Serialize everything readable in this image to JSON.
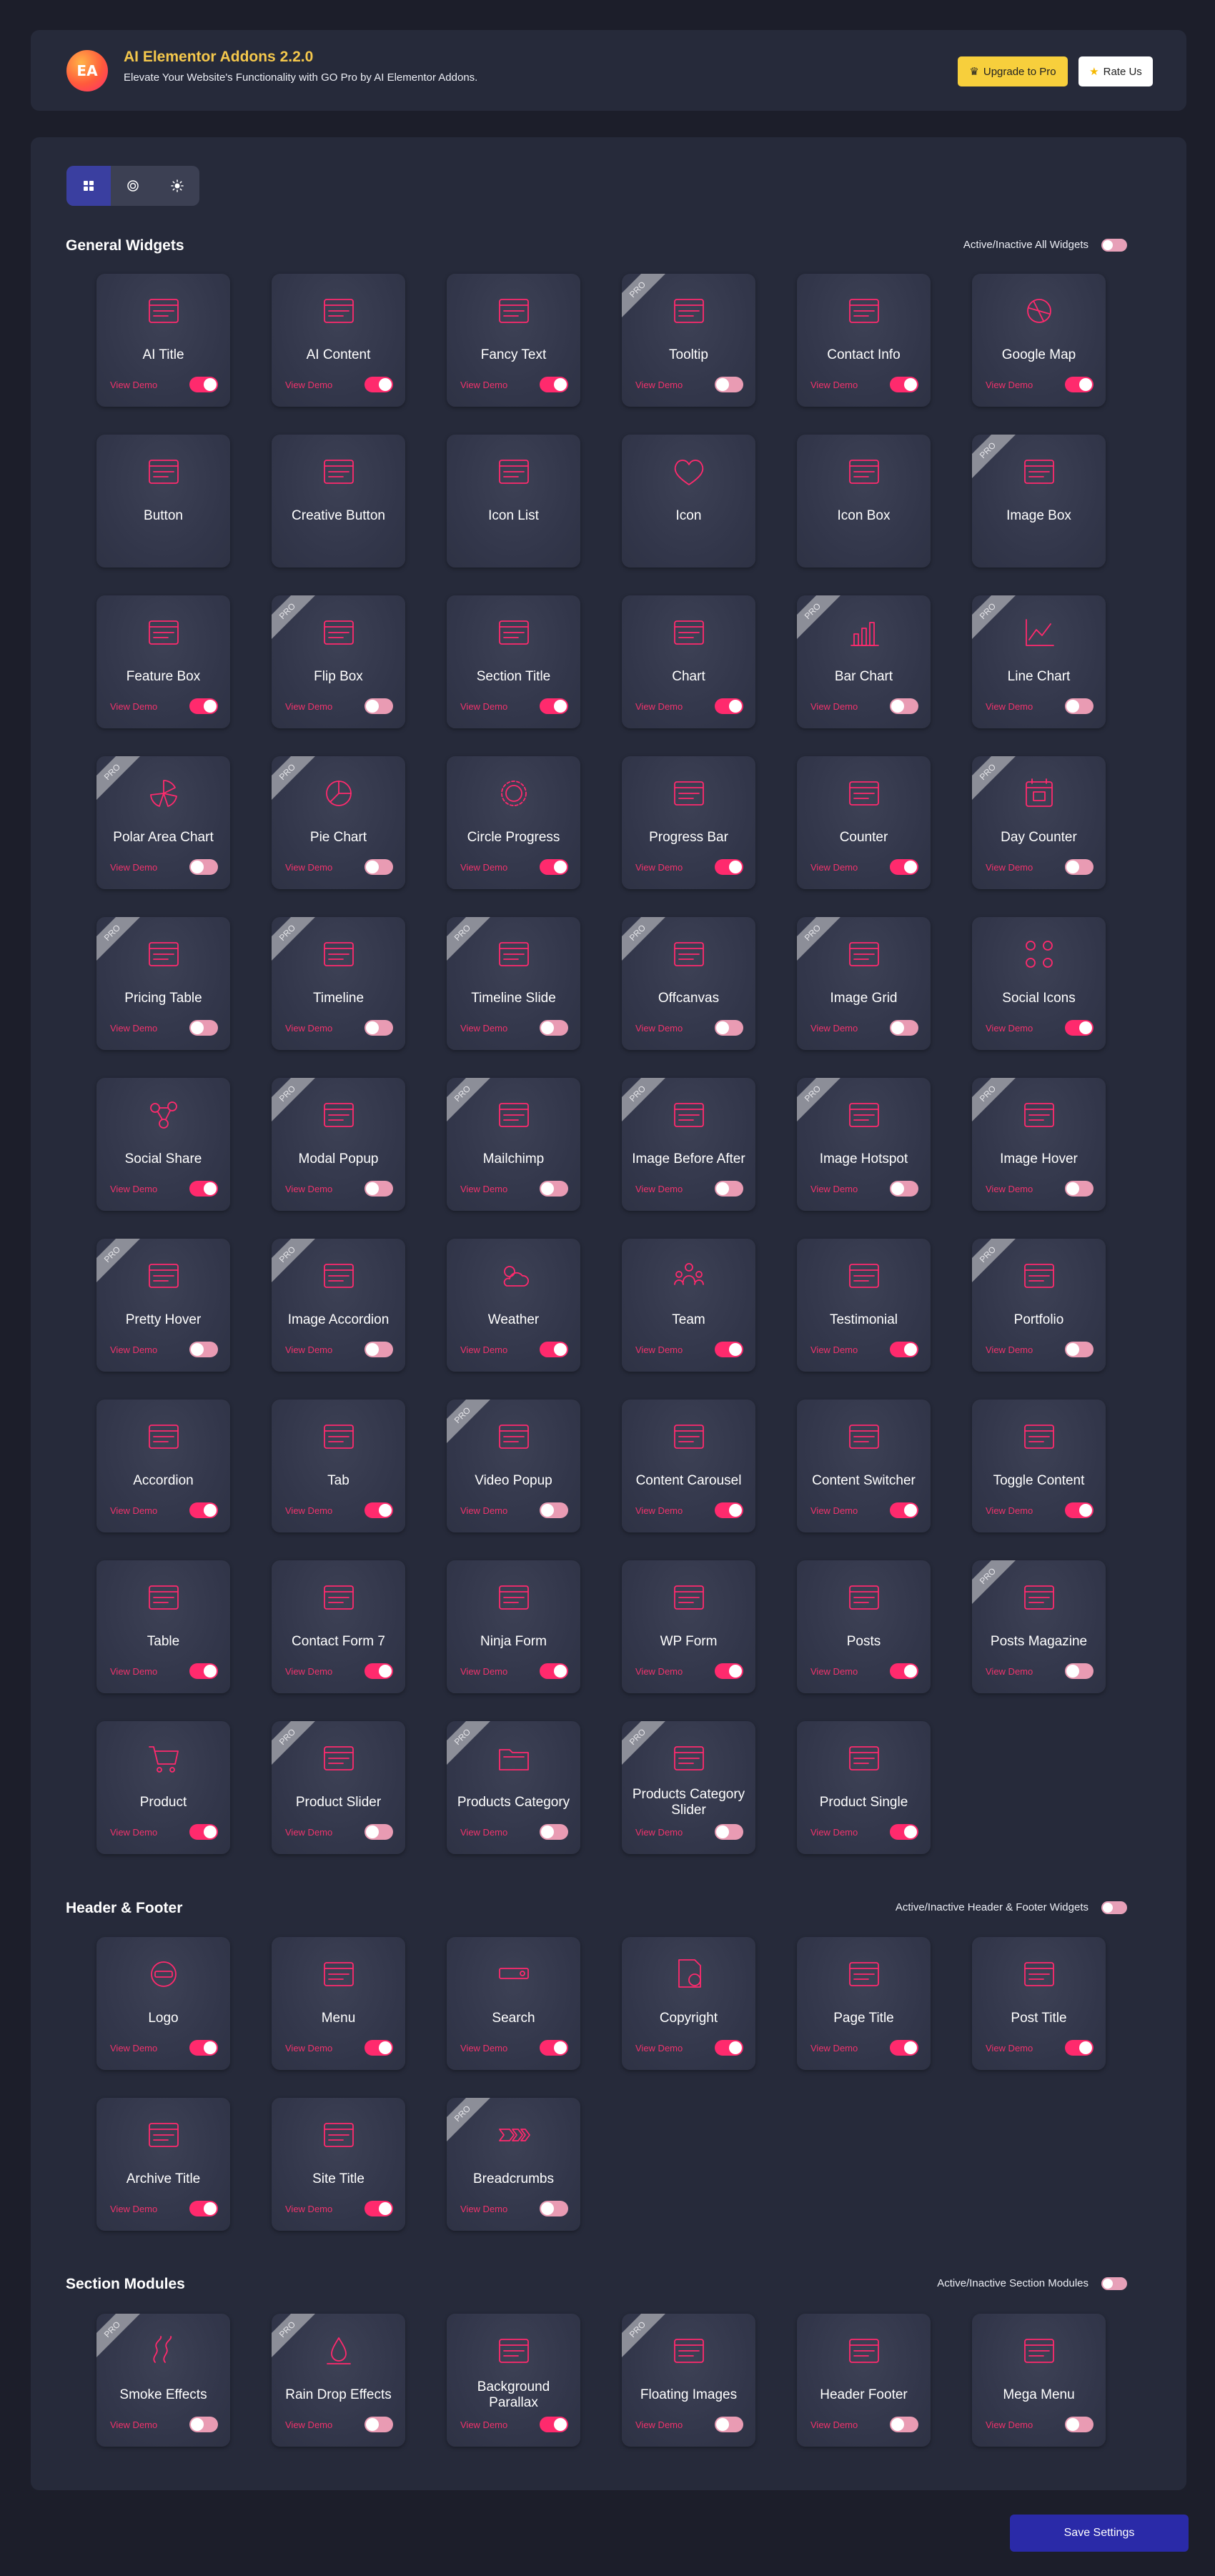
{
  "header": {
    "logo_text": "EA",
    "title": "AI Elementor Addons 2.2.0",
    "subtitle": "Elevate Your Website's Functionality with GO Pro by AI Elementor Addons.",
    "upgrade_label": "Upgrade to Pro",
    "rate_label": "Rate Us"
  },
  "tabs": [
    {
      "icon": "grid-icon",
      "active": true
    },
    {
      "icon": "target-icon",
      "active": false
    },
    {
      "icon": "sun-icon",
      "active": false
    }
  ],
  "colors": {
    "accent": "#ff2a6d",
    "pro_yellow": "#f7cf3c",
    "save_blue": "#2a2aa8"
  },
  "demo_label": "View Demo",
  "pro_label": "PRO",
  "sections": [
    {
      "title": "General Widgets",
      "toggle_label": "Active/Inactive All Widgets",
      "widgets": [
        {
          "name": "AI Title",
          "pro": false,
          "on": true,
          "demo": true,
          "icon": "title-icon"
        },
        {
          "name": "AI Content",
          "pro": false,
          "on": true,
          "demo": true,
          "icon": "content-icon"
        },
        {
          "name": "Fancy Text",
          "pro": false,
          "on": true,
          "demo": true,
          "icon": "fancy-text-icon"
        },
        {
          "name": "Tooltip",
          "pro": true,
          "on": false,
          "demo": true,
          "icon": "tooltip-icon"
        },
        {
          "name": "Contact Info",
          "pro": false,
          "on": true,
          "demo": true,
          "icon": "contact-icon"
        },
        {
          "name": "Google Map",
          "pro": false,
          "on": true,
          "demo": true,
          "icon": "map-icon"
        },
        {
          "name": "Button",
          "pro": false,
          "on": false,
          "demo": false,
          "icon": "button-icon"
        },
        {
          "name": "Creative Button",
          "pro": false,
          "on": false,
          "demo": false,
          "icon": "creative-button-icon"
        },
        {
          "name": "Icon List",
          "pro": false,
          "on": false,
          "demo": false,
          "icon": "list-icon"
        },
        {
          "name": "Icon",
          "pro": false,
          "on": false,
          "demo": false,
          "icon": "heart-icon"
        },
        {
          "name": "Icon Box",
          "pro": false,
          "on": false,
          "demo": false,
          "icon": "icon-box-icon"
        },
        {
          "name": "Image Box",
          "pro": true,
          "on": false,
          "demo": false,
          "icon": "image-box-icon"
        },
        {
          "name": "Feature Box",
          "pro": false,
          "on": true,
          "demo": true,
          "icon": "feature-icon"
        },
        {
          "name": "Flip Box",
          "pro": true,
          "on": false,
          "demo": true,
          "icon": "flip-box-icon"
        },
        {
          "name": "Section Title",
          "pro": false,
          "on": true,
          "demo": true,
          "icon": "section-title-icon"
        },
        {
          "name": "Chart",
          "pro": false,
          "on": true,
          "demo": true,
          "icon": "chart-icon"
        },
        {
          "name": "Bar Chart",
          "pro": true,
          "on": false,
          "demo": true,
          "icon": "bar-chart-icon"
        },
        {
          "name": "Line Chart",
          "pro": true,
          "on": false,
          "demo": true,
          "icon": "line-chart-icon"
        },
        {
          "name": "Polar Area Chart",
          "pro": true,
          "on": false,
          "demo": true,
          "icon": "polar-chart-icon"
        },
        {
          "name": "Pie Chart",
          "pro": true,
          "on": false,
          "demo": true,
          "icon": "pie-chart-icon"
        },
        {
          "name": "Circle Progress",
          "pro": false,
          "on": true,
          "demo": true,
          "icon": "circle-progress-icon"
        },
        {
          "name": "Progress Bar",
          "pro": false,
          "on": true,
          "demo": true,
          "icon": "progress-bar-icon"
        },
        {
          "name": "Counter",
          "pro": false,
          "on": true,
          "demo": true,
          "icon": "counter-icon"
        },
        {
          "name": "Day Counter",
          "pro": true,
          "on": false,
          "demo": true,
          "icon": "calendar-icon"
        },
        {
          "name": "Pricing Table",
          "pro": true,
          "on": false,
          "demo": true,
          "icon": "pricing-icon"
        },
        {
          "name": "Timeline",
          "pro": true,
          "on": false,
          "demo": true,
          "icon": "timeline-icon"
        },
        {
          "name": "Timeline Slide",
          "pro": true,
          "on": false,
          "demo": true,
          "icon": "timeline-slide-icon"
        },
        {
          "name": "Offcanvas",
          "pro": true,
          "on": false,
          "demo": true,
          "icon": "offcanvas-icon"
        },
        {
          "name": "Image Grid",
          "pro": true,
          "on": false,
          "demo": true,
          "icon": "image-grid-icon"
        },
        {
          "name": "Social Icons",
          "pro": false,
          "on": true,
          "demo": true,
          "icon": "social-icons-icon"
        },
        {
          "name": "Social Share",
          "pro": false,
          "on": true,
          "demo": true,
          "icon": "share-icon"
        },
        {
          "name": "Modal Popup",
          "pro": true,
          "on": false,
          "demo": true,
          "icon": "modal-icon"
        },
        {
          "name": "Mailchimp",
          "pro": true,
          "on": false,
          "demo": true,
          "icon": "mailchimp-icon"
        },
        {
          "name": "Image Before After",
          "pro": true,
          "on": false,
          "demo": true,
          "icon": "before-after-icon"
        },
        {
          "name": "Image Hotspot",
          "pro": true,
          "on": false,
          "demo": true,
          "icon": "hotspot-icon"
        },
        {
          "name": "Image Hover",
          "pro": true,
          "on": false,
          "demo": true,
          "icon": "image-hover-icon"
        },
        {
          "name": "Pretty Hover",
          "pro": true,
          "on": false,
          "demo": true,
          "icon": "pretty-hover-icon"
        },
        {
          "name": "Image Accordion",
          "pro": true,
          "on": false,
          "demo": true,
          "icon": "image-accordion-icon"
        },
        {
          "name": "Weather",
          "pro": false,
          "on": true,
          "demo": true,
          "icon": "weather-icon"
        },
        {
          "name": "Team",
          "pro": false,
          "on": true,
          "demo": true,
          "icon": "team-icon"
        },
        {
          "name": "Testimonial",
          "pro": false,
          "on": true,
          "demo": true,
          "icon": "testimonial-icon"
        },
        {
          "name": "Portfolio",
          "pro": true,
          "on": false,
          "demo": true,
          "icon": "portfolio-icon"
        },
        {
          "name": "Accordion",
          "pro": false,
          "on": true,
          "demo": true,
          "icon": "accordion-icon"
        },
        {
          "name": "Tab",
          "pro": false,
          "on": true,
          "demo": true,
          "icon": "tab-icon"
        },
        {
          "name": "Video Popup",
          "pro": true,
          "on": false,
          "demo": true,
          "icon": "video-icon"
        },
        {
          "name": "Content Carousel",
          "pro": false,
          "on": true,
          "demo": true,
          "icon": "carousel-icon"
        },
        {
          "name": "Content Switcher",
          "pro": false,
          "on": true,
          "demo": true,
          "icon": "switcher-icon"
        },
        {
          "name": "Toggle Content",
          "pro": false,
          "on": true,
          "demo": true,
          "icon": "toggle-content-icon"
        },
        {
          "name": "Table",
          "pro": false,
          "on": true,
          "demo": true,
          "icon": "table-icon"
        },
        {
          "name": "Contact Form 7",
          "pro": false,
          "on": true,
          "demo": true,
          "icon": "form-icon"
        },
        {
          "name": "Ninja Form",
          "pro": false,
          "on": true,
          "demo": true,
          "icon": "ninja-form-icon"
        },
        {
          "name": "WP Form",
          "pro": false,
          "on": true,
          "demo": true,
          "icon": "wp-form-icon"
        },
        {
          "name": "Posts",
          "pro": false,
          "on": true,
          "demo": true,
          "icon": "posts-icon"
        },
        {
          "name": "Posts Magazine",
          "pro": true,
          "on": false,
          "demo": true,
          "icon": "magazine-icon"
        },
        {
          "name": "Product",
          "pro": false,
          "on": true,
          "demo": true,
          "icon": "cart-icon"
        },
        {
          "name": "Product Slider",
          "pro": true,
          "on": false,
          "demo": true,
          "icon": "product-slider-icon"
        },
        {
          "name": "Products Category",
          "pro": true,
          "on": false,
          "demo": true,
          "icon": "folder-icon"
        },
        {
          "name": "Products Category Slider",
          "pro": true,
          "on": false,
          "demo": true,
          "icon": "category-slider-icon"
        },
        {
          "name": "Product Single",
          "pro": false,
          "on": true,
          "demo": true,
          "icon": "product-single-icon"
        }
      ]
    },
    {
      "title": "Header & Footer",
      "toggle_label": "Active/Inactive Header & Footer Widgets",
      "widgets": [
        {
          "name": "Logo",
          "pro": false,
          "on": true,
          "demo": true,
          "icon": "logo-icon"
        },
        {
          "name": "Menu",
          "pro": false,
          "on": true,
          "demo": true,
          "icon": "menu-icon"
        },
        {
          "name": "Search",
          "pro": false,
          "on": true,
          "demo": true,
          "icon": "search-icon"
        },
        {
          "name": "Copyright",
          "pro": false,
          "on": true,
          "demo": true,
          "icon": "copyright-icon"
        },
        {
          "name": "Page Title",
          "pro": false,
          "on": true,
          "demo": true,
          "icon": "page-title-icon"
        },
        {
          "name": "Post Title",
          "pro": false,
          "on": true,
          "demo": true,
          "icon": "post-title-icon"
        },
        {
          "name": "Archive Title",
          "pro": false,
          "on": true,
          "demo": true,
          "icon": "archive-icon"
        },
        {
          "name": "Site Title",
          "pro": false,
          "on": true,
          "demo": true,
          "icon": "site-title-icon"
        },
        {
          "name": "Breadcrumbs",
          "pro": true,
          "on": false,
          "demo": true,
          "icon": "breadcrumbs-icon"
        }
      ]
    },
    {
      "title": "Section Modules",
      "toggle_label": "Active/Inactive Section Modules",
      "widgets": [
        {
          "name": "Smoke Effects",
          "pro": true,
          "on": false,
          "demo": true,
          "icon": "smoke-icon"
        },
        {
          "name": "Rain Drop Effects",
          "pro": true,
          "on": false,
          "demo": true,
          "icon": "rain-icon"
        },
        {
          "name": "Background Parallax",
          "pro": false,
          "on": true,
          "demo": true,
          "icon": "parallax-icon"
        },
        {
          "name": "Floating Images",
          "pro": true,
          "on": false,
          "demo": true,
          "icon": "floating-icon"
        },
        {
          "name": "Header Footer",
          "pro": false,
          "on": false,
          "demo": true,
          "icon": "header-footer-icon"
        },
        {
          "name": "Mega Menu",
          "pro": false,
          "on": false,
          "demo": true,
          "icon": "mega-menu-icon"
        }
      ]
    }
  ],
  "save_label": "Save Settings"
}
